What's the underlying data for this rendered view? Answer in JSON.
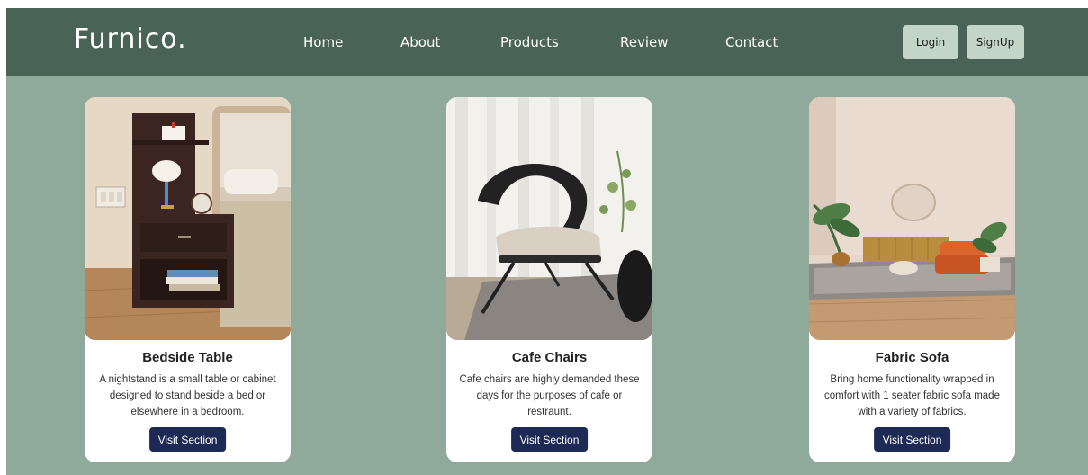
{
  "header": {
    "logo": "Furnico.",
    "nav": {
      "home": "Home",
      "about": "About",
      "products": "Products",
      "review": "Review",
      "contact": "Contact"
    },
    "login_label": "Login",
    "signup_label": "SignUp"
  },
  "products": [
    {
      "title": "Bedside Table",
      "description": "A nightstand is a small table or cabinet designed to stand beside a bed or elsewhere in a bedroom.",
      "button": "Visit Section"
    },
    {
      "title": "Cafe Chairs",
      "description": "Cafe chairs are highly demanded these days for the purposes of cafe or restraunt.",
      "button": "Visit Section"
    },
    {
      "title": "Fabric Sofa",
      "description": "Bring home functionality wrapped in comfort with 1 seater fabric sofa made with a variety of fabrics.",
      "button": "Visit Section"
    }
  ],
  "colors": {
    "page_background": "#8fa99a",
    "navbar": "#4a6357",
    "auth_button": "#c2d5c7",
    "visit_button": "#1c2a55"
  }
}
